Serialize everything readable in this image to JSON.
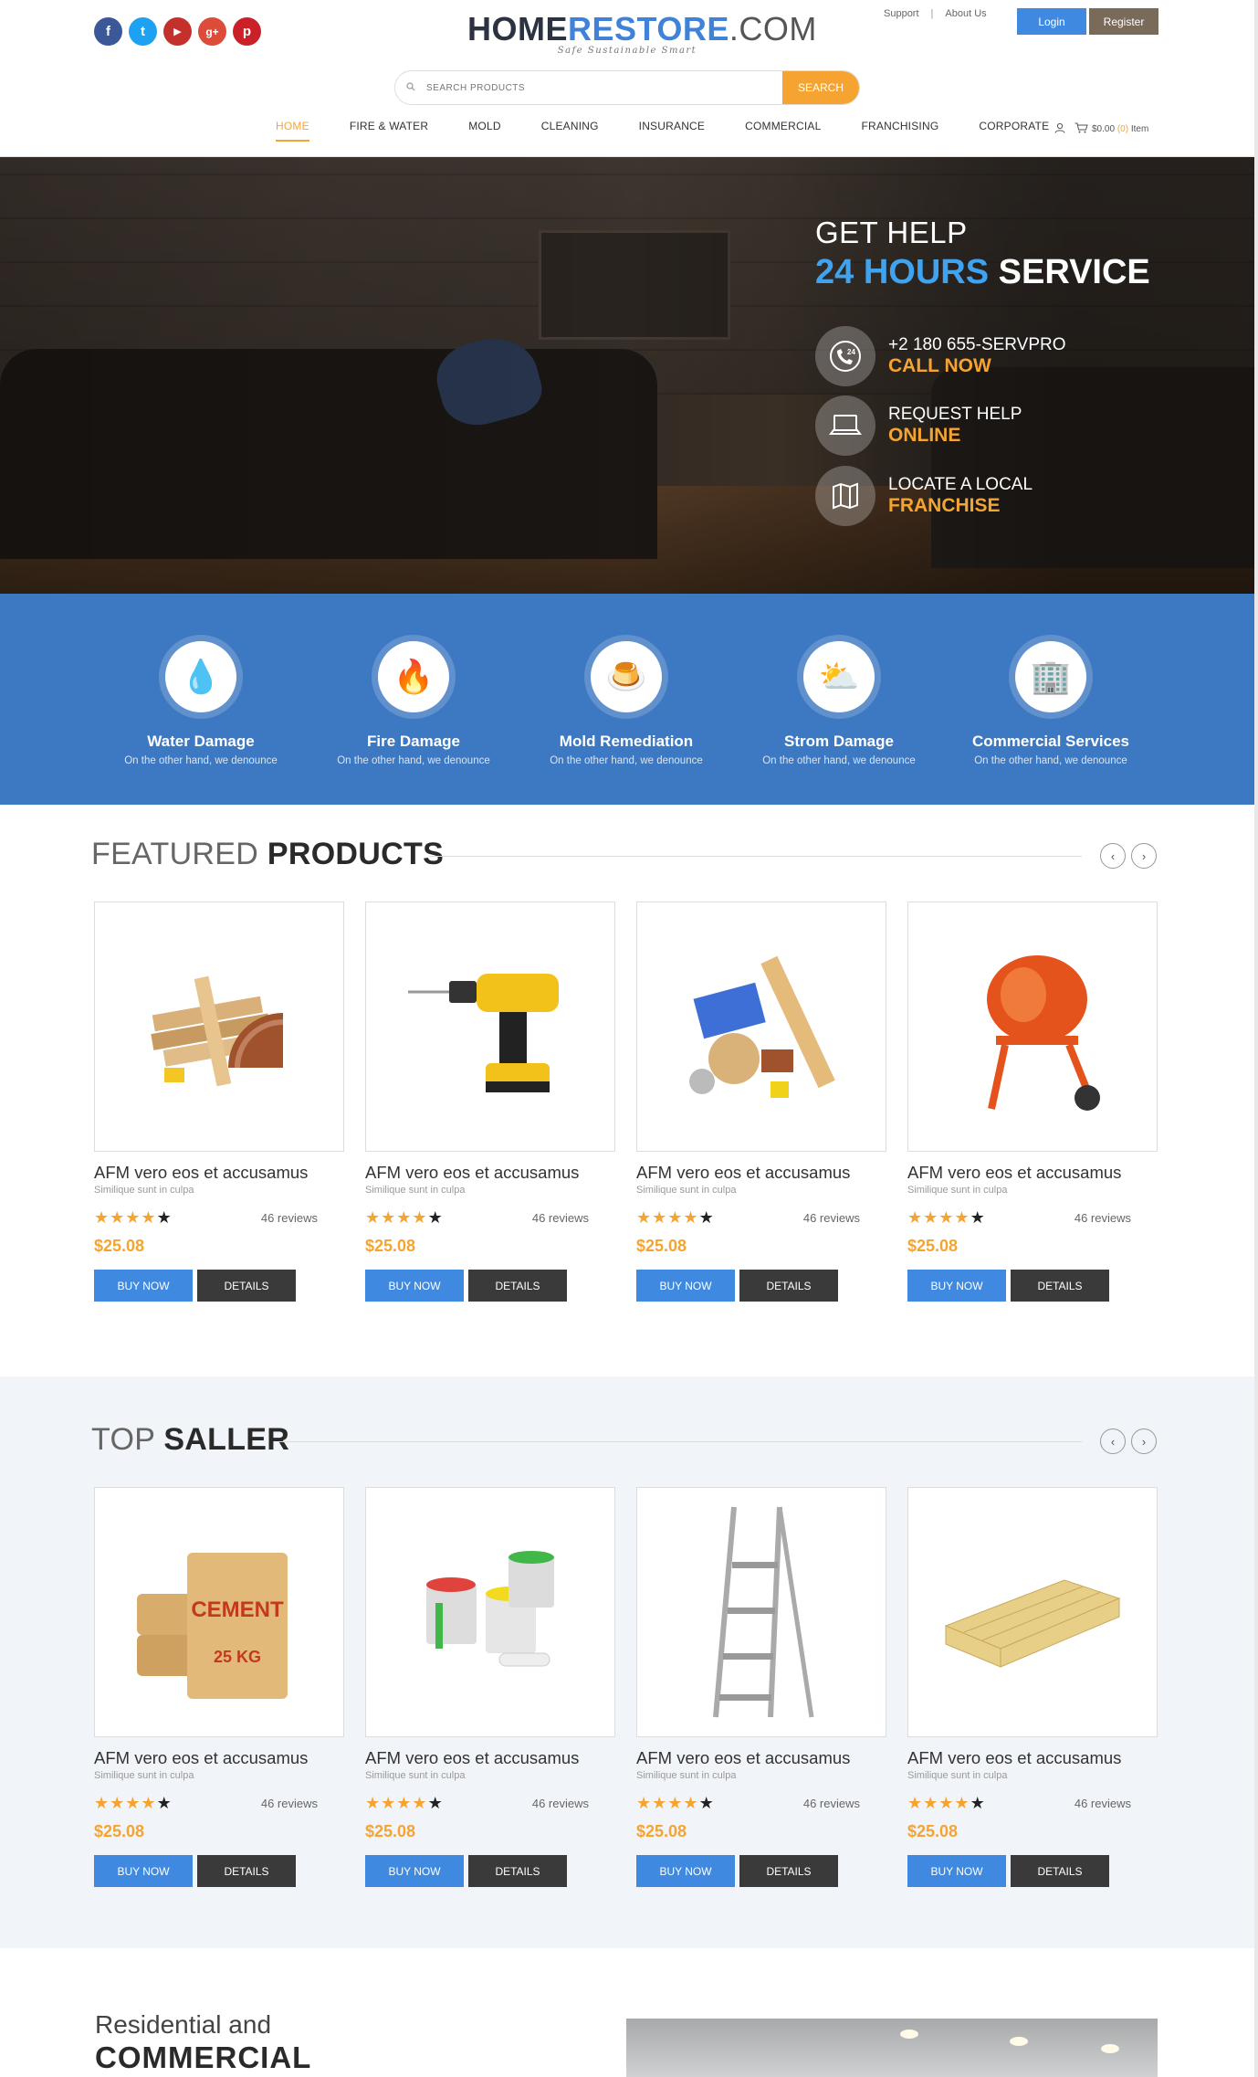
{
  "social": [
    {
      "name": "facebook",
      "glyph": "f",
      "color": "#3b5998"
    },
    {
      "name": "twitter",
      "glyph": "t",
      "color": "#1da1f2"
    },
    {
      "name": "youtube",
      "glyph": "▶",
      "color": "#c4302b"
    },
    {
      "name": "google-plus",
      "glyph": "g+",
      "color": "#dd4b39"
    },
    {
      "name": "pinterest",
      "glyph": "p",
      "color": "#cb2027"
    }
  ],
  "logo": {
    "part1": "HOME",
    "part2": "RESTORE",
    "part3": ".COM",
    "tagline": "Safe Sustainable Smart"
  },
  "top_links": {
    "support": "Support",
    "sep": "|",
    "about": "About Us",
    "login": "Login",
    "register": "Register"
  },
  "search": {
    "placeholder": "SEARCH PRODUCTS",
    "button": "SEARCH"
  },
  "nav": [
    "HOME",
    "FIRE & WATER",
    "MOLD",
    "CLEANING",
    "INSURANCE",
    "COMMERCIAL",
    "FRANCHISING",
    "CORPORATE"
  ],
  "cart": {
    "amount": "$0.00",
    "count": "(0)",
    "label": "Item"
  },
  "hero": {
    "line1": "GET HELP",
    "line2a": "24 HOURS",
    "line2b": "SERVICE",
    "items": [
      {
        "icon": "phone-24-icon",
        "l1": "+2 180 655-SERVPRO",
        "l2": "CALL NOW"
      },
      {
        "icon": "laptop-icon",
        "l1": "REQUEST HELP",
        "l2": "ONLINE"
      },
      {
        "icon": "map-icon",
        "l1": "LOCATE A LOCAL",
        "l2": "FRANCHISE"
      }
    ]
  },
  "services": [
    {
      "icon": "water-drop-icon",
      "glyph": "💧",
      "title": "Water Damage",
      "desc": "On the other hand, we denounce"
    },
    {
      "icon": "fire-icon",
      "glyph": "🔥",
      "title": "Fire Damage",
      "desc": "On the other hand, we denounce"
    },
    {
      "icon": "mold-icon",
      "glyph": "🍮",
      "title": "Mold Remediation",
      "desc": "On the other hand, we denounce"
    },
    {
      "icon": "storm-icon",
      "glyph": "⛅",
      "title": "Strom Damage",
      "desc": "On the other hand, we denounce"
    },
    {
      "icon": "building-icon",
      "glyph": "🏢",
      "title": "Commercial Services",
      "desc": "On the other hand, we denounce"
    }
  ],
  "featured": {
    "title_light": "FEATURED",
    "title_bold": "PRODUCTS",
    "products": [
      {
        "image": "wood-planks-image",
        "name": "AFM vero eos et accusamus",
        "sub": "Similique sunt in culpa",
        "reviews": "46 reviews",
        "price": "$25.08",
        "buy": "BUY NOW",
        "details": "DETAILS",
        "rating": 4.5
      },
      {
        "image": "cordless-drill-image",
        "name": "AFM vero eos et accusamus",
        "sub": "Similique sunt in culpa",
        "reviews": "46 reviews",
        "price": "$25.08",
        "buy": "BUY NOW",
        "details": "DETAILS",
        "rating": 4.5
      },
      {
        "image": "building-materials-image",
        "name": "AFM vero eos et accusamus",
        "sub": "Similique sunt in culpa",
        "reviews": "46 reviews",
        "price": "$25.08",
        "buy": "BUY NOW",
        "details": "DETAILS",
        "rating": 4.5
      },
      {
        "image": "cement-mixer-image",
        "name": "AFM vero eos et accusamus",
        "sub": "Similique sunt in culpa",
        "reviews": "46 reviews",
        "price": "$25.08",
        "buy": "BUY NOW",
        "details": "DETAILS",
        "rating": 4.5
      }
    ]
  },
  "top_seller": {
    "title_light": "TOP",
    "title_bold": "SALLER",
    "products": [
      {
        "image": "cement-bags-image",
        "name": "AFM vero eos et accusamus",
        "sub": "Similique sunt in culpa",
        "reviews": "46 reviews",
        "price": "$25.08",
        "buy": "BUY NOW",
        "details": "DETAILS",
        "rating": 4.5
      },
      {
        "image": "paint-cans-image",
        "name": "AFM vero eos et accusamus",
        "sub": "Similique sunt in culpa",
        "reviews": "46 reviews",
        "price": "$25.08",
        "buy": "BUY NOW",
        "details": "DETAILS",
        "rating": 4.5
      },
      {
        "image": "step-ladder-image",
        "name": "AFM vero eos et accusamus",
        "sub": "Similique sunt in culpa",
        "reviews": "46 reviews",
        "price": "$25.08",
        "buy": "BUY NOW",
        "details": "DETAILS",
        "rating": 4.5
      },
      {
        "image": "lumber-stack-image",
        "name": "AFM vero eos et accusamus",
        "sub": "Similique sunt in culpa",
        "reviews": "46 reviews",
        "price": "$25.08",
        "buy": "BUY NOW",
        "details": "DETAILS",
        "rating": 4.5
      }
    ]
  },
  "residential": {
    "line1": "Residential and",
    "line2": "COMMERCIAL"
  },
  "colors": {
    "blue": "#3f8ae0",
    "orange": "#f5a431",
    "services_bg": "#3d79c2",
    "dark_button": "#3a3a3a"
  }
}
